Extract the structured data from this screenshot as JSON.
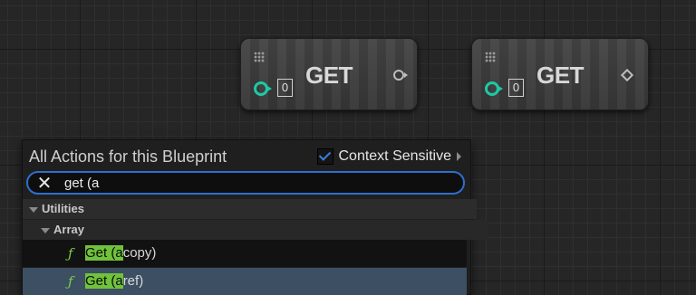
{
  "nodes": [
    {
      "title": "GET",
      "index": "0",
      "output_pin": "circle-pin-icon"
    },
    {
      "title": "GET",
      "index": "0",
      "output_pin": "diamond-pin-icon"
    }
  ],
  "action_menu": {
    "title": "All Actions for this Blueprint",
    "context_sensitive_label": "Context Sensitive",
    "context_sensitive_checked": true,
    "search_value": "get (a",
    "categories": [
      {
        "label": "Utilities"
      },
      {
        "label": "Array"
      }
    ],
    "items": [
      {
        "highlight": "Get (a",
        "rest": "copy)"
      },
      {
        "highlight": "Get (a",
        "rest": "ref)"
      }
    ]
  },
  "colors": {
    "exec_pin": "#1dc9a5",
    "match_highlight": "#6fc23a",
    "search_border": "#2d6fd0",
    "selected_row": "#3c4f63"
  }
}
